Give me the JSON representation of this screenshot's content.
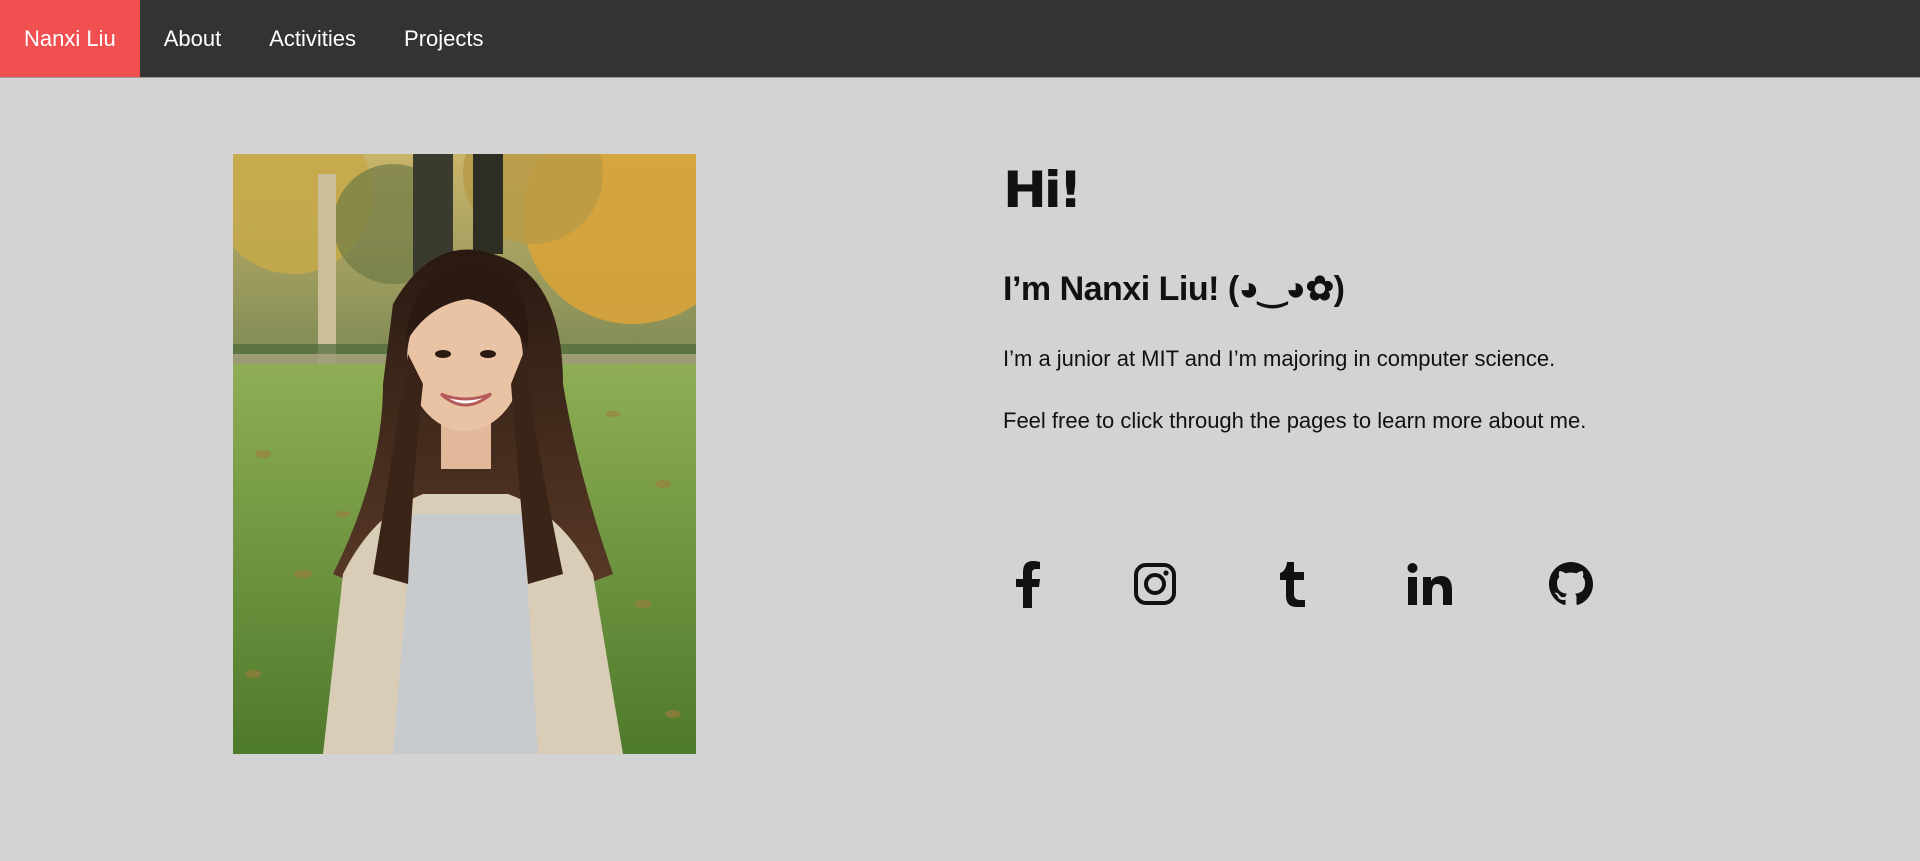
{
  "nav": {
    "brand": "Nanxi Liu",
    "items": [
      {
        "label": "About"
      },
      {
        "label": "Activities"
      },
      {
        "label": "Projects"
      }
    ],
    "active_color": "#f05050",
    "bar_color": "#333333"
  },
  "intro": {
    "greeting": "Hi!",
    "name_line": "I’m Nanxi Liu! (◕‿◕✿)",
    "paragraphs": [
      "I’m a junior at MIT and I’m majoring in computer science.",
      "Feel free to click through the pages to learn more about me."
    ]
  },
  "socials": [
    {
      "icon": "facebook-icon"
    },
    {
      "icon": "instagram-icon"
    },
    {
      "icon": "tumblr-icon"
    },
    {
      "icon": "linkedin-icon"
    },
    {
      "icon": "github-icon"
    }
  ],
  "colors": {
    "page_background": "#d3d3d3",
    "text": "#111111"
  }
}
